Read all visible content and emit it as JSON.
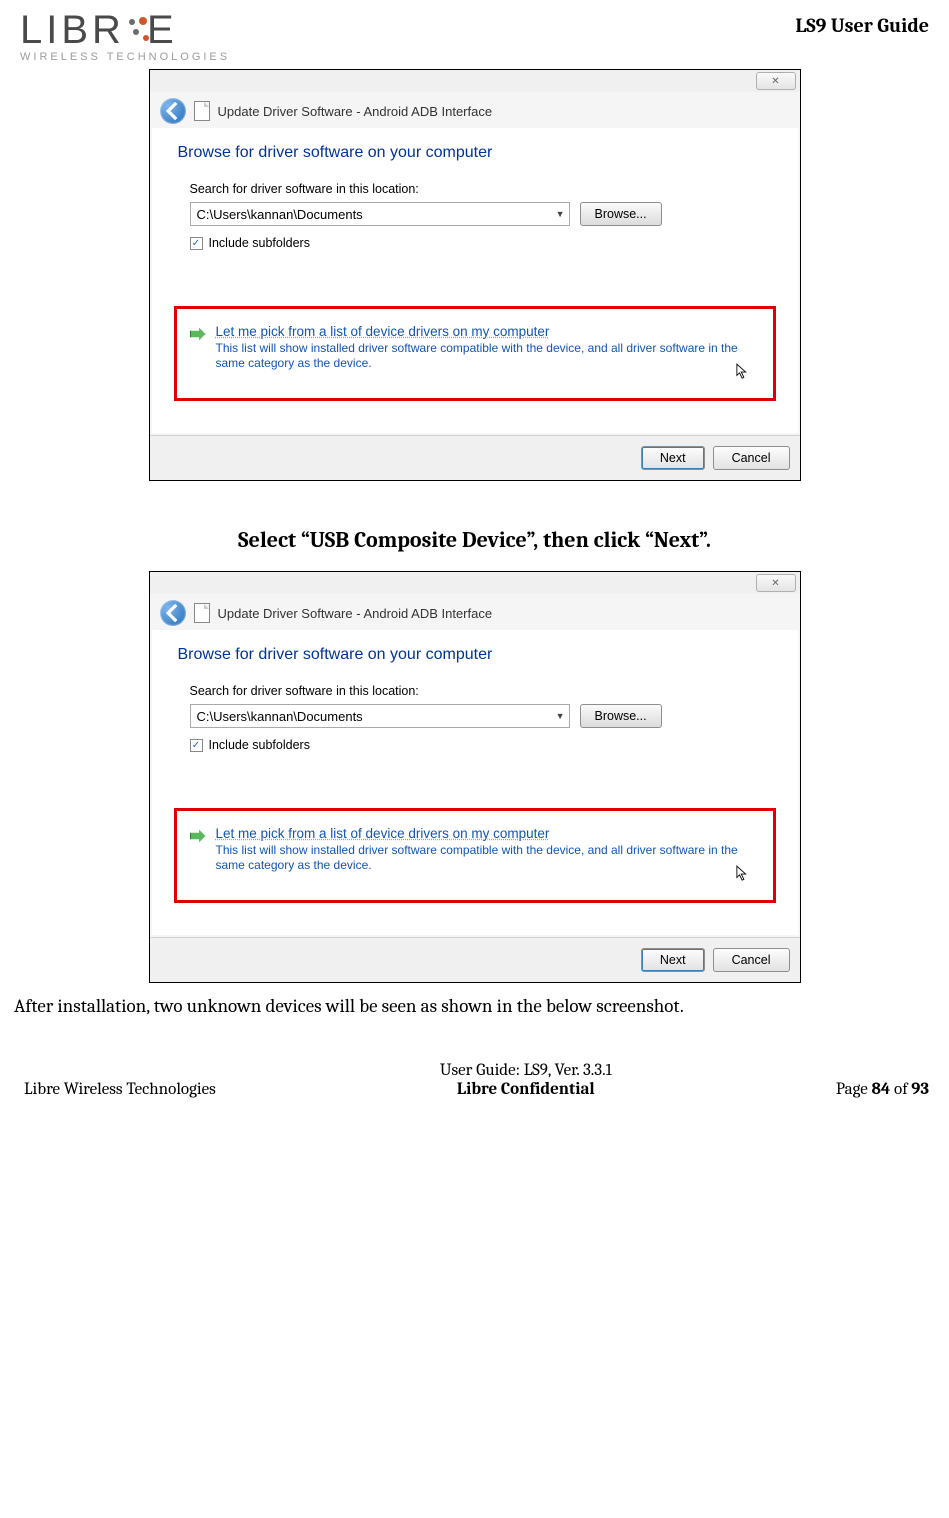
{
  "logo": {
    "word": "LIBRE",
    "sub": "WIRELESS TECHNOLOGIES"
  },
  "guide_title": "LS9 User Guide",
  "dialog": {
    "title": "Update Driver Software - Android ADB Interface",
    "heading": "Browse for driver software on your computer",
    "search_label": "Search for driver software in this location:",
    "path": "C:\\Users\\kannan\\Documents",
    "browse": "Browse...",
    "include_subfolders": "Include subfolders",
    "option_title": "Let me pick from a list of device drivers on my computer",
    "option_desc": "This list will show installed driver software compatible with the device, and all driver software in the same category as the device.",
    "next": "Next",
    "cancel": "Cancel",
    "close_glyph": "✕"
  },
  "step_text": "Select “USB Composite Device”, then click “Next”.",
  "after_text": "After installation, two unknown devices will be seen as shown in the below screenshot.",
  "footer": {
    "left": "Libre Wireless Technologies",
    "center1": "User Guide: LS9, Ver. 3.3.1",
    "center2": "Libre Confidential",
    "right_prefix": "Page ",
    "right_page": "84",
    "right_mid": " of ",
    "right_total": "93"
  }
}
